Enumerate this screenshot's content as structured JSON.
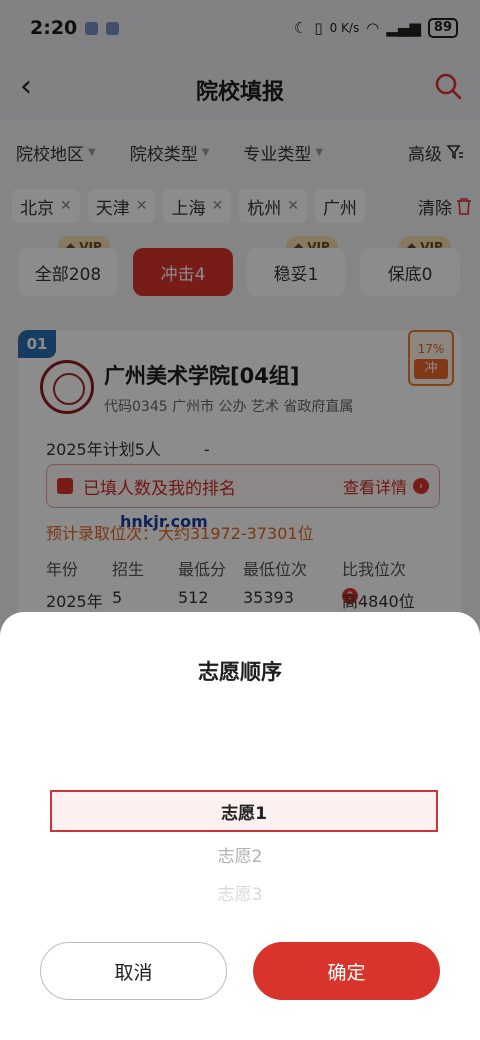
{
  "status_bar": {
    "time": "2:20",
    "net_speed": "0 K/s",
    "battery": "89"
  },
  "header": {
    "title": "院校填报"
  },
  "filters": [
    {
      "label": "院校地区"
    },
    {
      "label": "院校类型"
    },
    {
      "label": "专业类型"
    }
  ],
  "filter_advanced": "高级",
  "selected_tags": [
    "北京",
    "天津",
    "上海",
    "杭州",
    "广州"
  ],
  "clear_label": "清除",
  "categories": [
    {
      "label": "全部208",
      "vip": "VIP"
    },
    {
      "label": "冲击4",
      "vip": ""
    },
    {
      "label": "稳妥1",
      "vip": "VIP"
    },
    {
      "label": "保底0",
      "vip": "VIP"
    }
  ],
  "school_card": {
    "rank": "01",
    "name": "广州美术学院[04组]",
    "meta": "代码0345 广州市 公办 艺术 省政府直属",
    "probability": "17%",
    "level": "冲",
    "plan": "2025年计划5人",
    "plan_extra": "-",
    "rank_box_label": "已填人数及我的排名",
    "rank_box_link": "查看详情",
    "estimate": "预计录取位次：大约31972-37301位",
    "watermark": "hnkjr.com",
    "table_headers": [
      "年份",
      "招生",
      "最低分",
      "最低位次",
      "比我位次"
    ],
    "table_row": [
      "2025年",
      "5",
      "512",
      "35393",
      "高4840位"
    ]
  },
  "sheet": {
    "title": "志愿顺序",
    "options": [
      "志愿1",
      "志愿2",
      "志愿3"
    ],
    "cancel_label": "取消",
    "confirm_label": "确定"
  },
  "colors": {
    "accent": "#d9342b",
    "rank_badge": "#2a6db0",
    "probability": "#e9672a"
  }
}
